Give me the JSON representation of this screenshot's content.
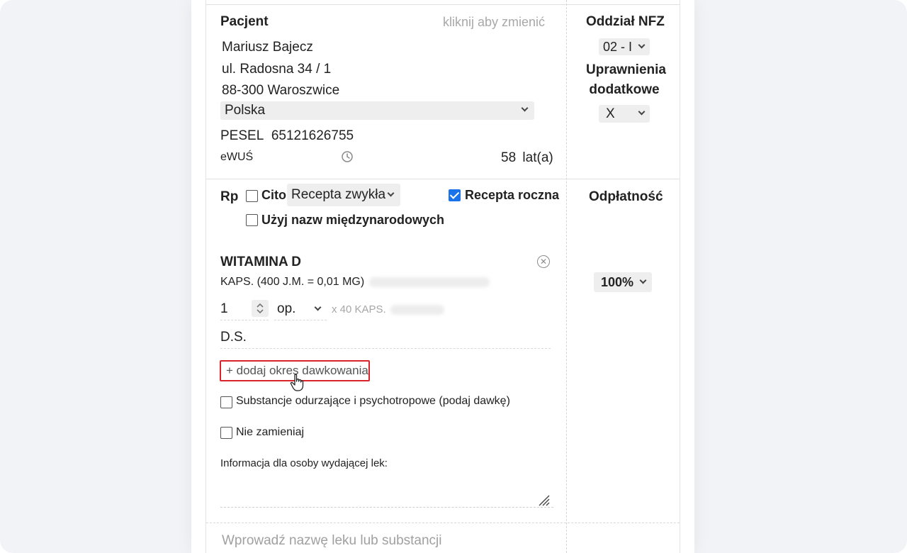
{
  "patient": {
    "heading": "Pacjent",
    "change_hint": "kliknij aby zmienić",
    "name": "Mariusz Bajecz",
    "street": "ul. Radosna 34 / 1",
    "city": "88-300 Waroszwice",
    "country": "Polska",
    "pesel_label": "PESEL",
    "pesel_value": "65121626755",
    "ewus_label": "eWUŚ",
    "age_value": "58",
    "age_unit": "lat(a)"
  },
  "nfz": {
    "heading": "Oddział NFZ",
    "branch_value": "02 - I",
    "permissions_heading_line1": "Uprawnienia",
    "permissions_heading_line2": "dodatkowe",
    "permissions_value": "X"
  },
  "prescription": {
    "rp_label": "Rp",
    "cito_label": "Cito",
    "cito_checked": false,
    "type_value": "Recepta zwykła",
    "annual_label": "Recepta roczna",
    "annual_checked": true,
    "intl_names_label": "Użyj nazw międzynarodowych",
    "intl_names_checked": false,
    "payment_heading": "Odpłatność"
  },
  "drug": {
    "name": "WITAMINA D",
    "form": "KAPS. (400 J.M. = 0,01 MG)",
    "quantity": "1",
    "unit": "op.",
    "package": "x 40 KAPS.",
    "ds_label": "D.S.",
    "add_dosing_period": "+ dodaj okres dawkowania",
    "narcotics_label": "Substancje odurzające i psychotropowe (podaj dawkę)",
    "narcotics_checked": false,
    "no_substitute_label": "Nie zamieniaj",
    "no_substitute_checked": false,
    "dispenser_info_label": "Informacja dla osoby wydającej lek:",
    "payment_value": "100%"
  },
  "search": {
    "placeholder": "Wprowadź nazwę leku lub substancji"
  },
  "colors": {
    "checkbox_checked": "#1a73e8",
    "highlight": "#d9252a"
  }
}
